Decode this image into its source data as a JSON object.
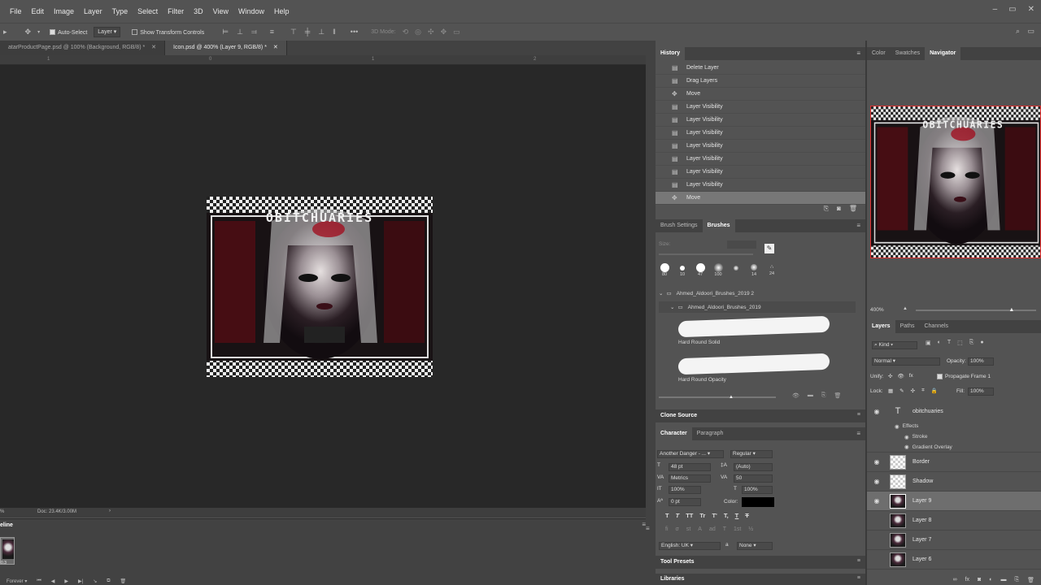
{
  "menu": [
    "File",
    "Edit",
    "Image",
    "Layer",
    "Type",
    "Select",
    "Filter",
    "3D",
    "View",
    "Window",
    "Help"
  ],
  "window_controls": {
    "minimize": "–",
    "restore": "▭",
    "close": "✕"
  },
  "options": {
    "auto_select_label": "Auto-Select",
    "auto_select_target": "Layer",
    "transform_label": "Show Transform Controls",
    "mode_3d_label": "3D Mode:"
  },
  "doc_tabs": [
    {
      "label": "atarProductPage.psd @ 100% (Background, RGB/8) *"
    },
    {
      "label": "Icon.psd @ 400% (Layer 9, RGB/8) *"
    }
  ],
  "ruler_marks": [
    "1",
    "0",
    "1",
    "2"
  ],
  "artwork_title": "OBITCHUARIES",
  "status": {
    "zoom": "%",
    "doc": "Doc: 23.4K/3.00M"
  },
  "timeline": {
    "title": "eline",
    "frame_time": "0.3",
    "loop": "Forever"
  },
  "history": {
    "tab": "History",
    "items": [
      {
        "label": "Delete Layer",
        "icon": "doc-icon"
      },
      {
        "label": "Drag Layers",
        "icon": "doc-icon"
      },
      {
        "label": "Move",
        "icon": "move-icon"
      },
      {
        "label": "Layer Visibility",
        "icon": "doc-icon"
      },
      {
        "label": "Layer Visibility",
        "icon": "doc-icon"
      },
      {
        "label": "Layer Visibility",
        "icon": "doc-icon"
      },
      {
        "label": "Layer Visibility",
        "icon": "doc-icon"
      },
      {
        "label": "Layer Visibility",
        "icon": "doc-icon"
      },
      {
        "label": "Layer Visibility",
        "icon": "doc-icon"
      },
      {
        "label": "Layer Visibility",
        "icon": "doc-icon"
      },
      {
        "label": "Move",
        "icon": "move-icon"
      }
    ]
  },
  "brushes": {
    "tabs": [
      "Brush Settings",
      "Brushes"
    ],
    "size_label": "Size:",
    "presets": [
      "80",
      "10",
      "47",
      "100",
      "",
      "14",
      "24"
    ],
    "folder1": "Ahmed_Aldoori_Brushes_2019 2",
    "folder2": "Ahmed_Aldoori_Brushes_2019",
    "brush1": "Hard Round Solid",
    "brush2": "Hard Round Opacity"
  },
  "clone_source": "Clone Source",
  "character": {
    "tabs": [
      "Character",
      "Paragraph"
    ],
    "font": "Another Danger - ...",
    "style": "Regular",
    "size": "48 pt",
    "leading": "(Auto)",
    "kerning": "Metrics",
    "tracking": "50",
    "vscale": "100%",
    "hscale": "100%",
    "baseline": "0 pt",
    "color_label": "Color:",
    "language": "English: UK",
    "aa": "None",
    "aa_label": "a",
    "type_buttons": [
      "T",
      "T",
      "TT",
      "Tr",
      "T'",
      "T,",
      "T",
      "T"
    ],
    "ot_buttons": [
      "fi",
      "σ",
      "st",
      "A",
      "ad",
      "T",
      "1st",
      "½"
    ]
  },
  "tool_presets": "Tool Presets",
  "libraries": "Libraries",
  "right_tabs": [
    "Color",
    "Swatches",
    "Navigator"
  ],
  "navigator": {
    "zoom": "400%",
    "zoom_fraction": 0.8
  },
  "layers": {
    "tabs": [
      "Layers",
      "Paths",
      "Channels"
    ],
    "filter": "Kind",
    "blend": "Normal",
    "opacity_label": "Opacity:",
    "opacity": "100%",
    "unify_label": "Unify:",
    "propagate_label": "Propagate Frame 1",
    "lock_label": "Lock:",
    "fill_label": "Fill:",
    "fill": "100%",
    "text_layer": "obitchuaries",
    "effects_label": "Effects",
    "effects": [
      "Stroke",
      "Gradient Overlay"
    ],
    "items": [
      {
        "name": "Border",
        "visible": true,
        "thumb": "checker"
      },
      {
        "name": "Shadow",
        "visible": true,
        "thumb": "checker"
      },
      {
        "name": "Layer 9",
        "visible": true,
        "thumb": "image",
        "selected": true
      },
      {
        "name": "Layer 8",
        "visible": false,
        "thumb": "image"
      },
      {
        "name": "Layer 7",
        "visible": false,
        "thumb": "image"
      },
      {
        "name": "Layer 6",
        "visible": false,
        "thumb": "image"
      }
    ]
  },
  "colors": {
    "accent": "#31a8ff",
    "canvas": "#282828",
    "panel": "#535353"
  }
}
